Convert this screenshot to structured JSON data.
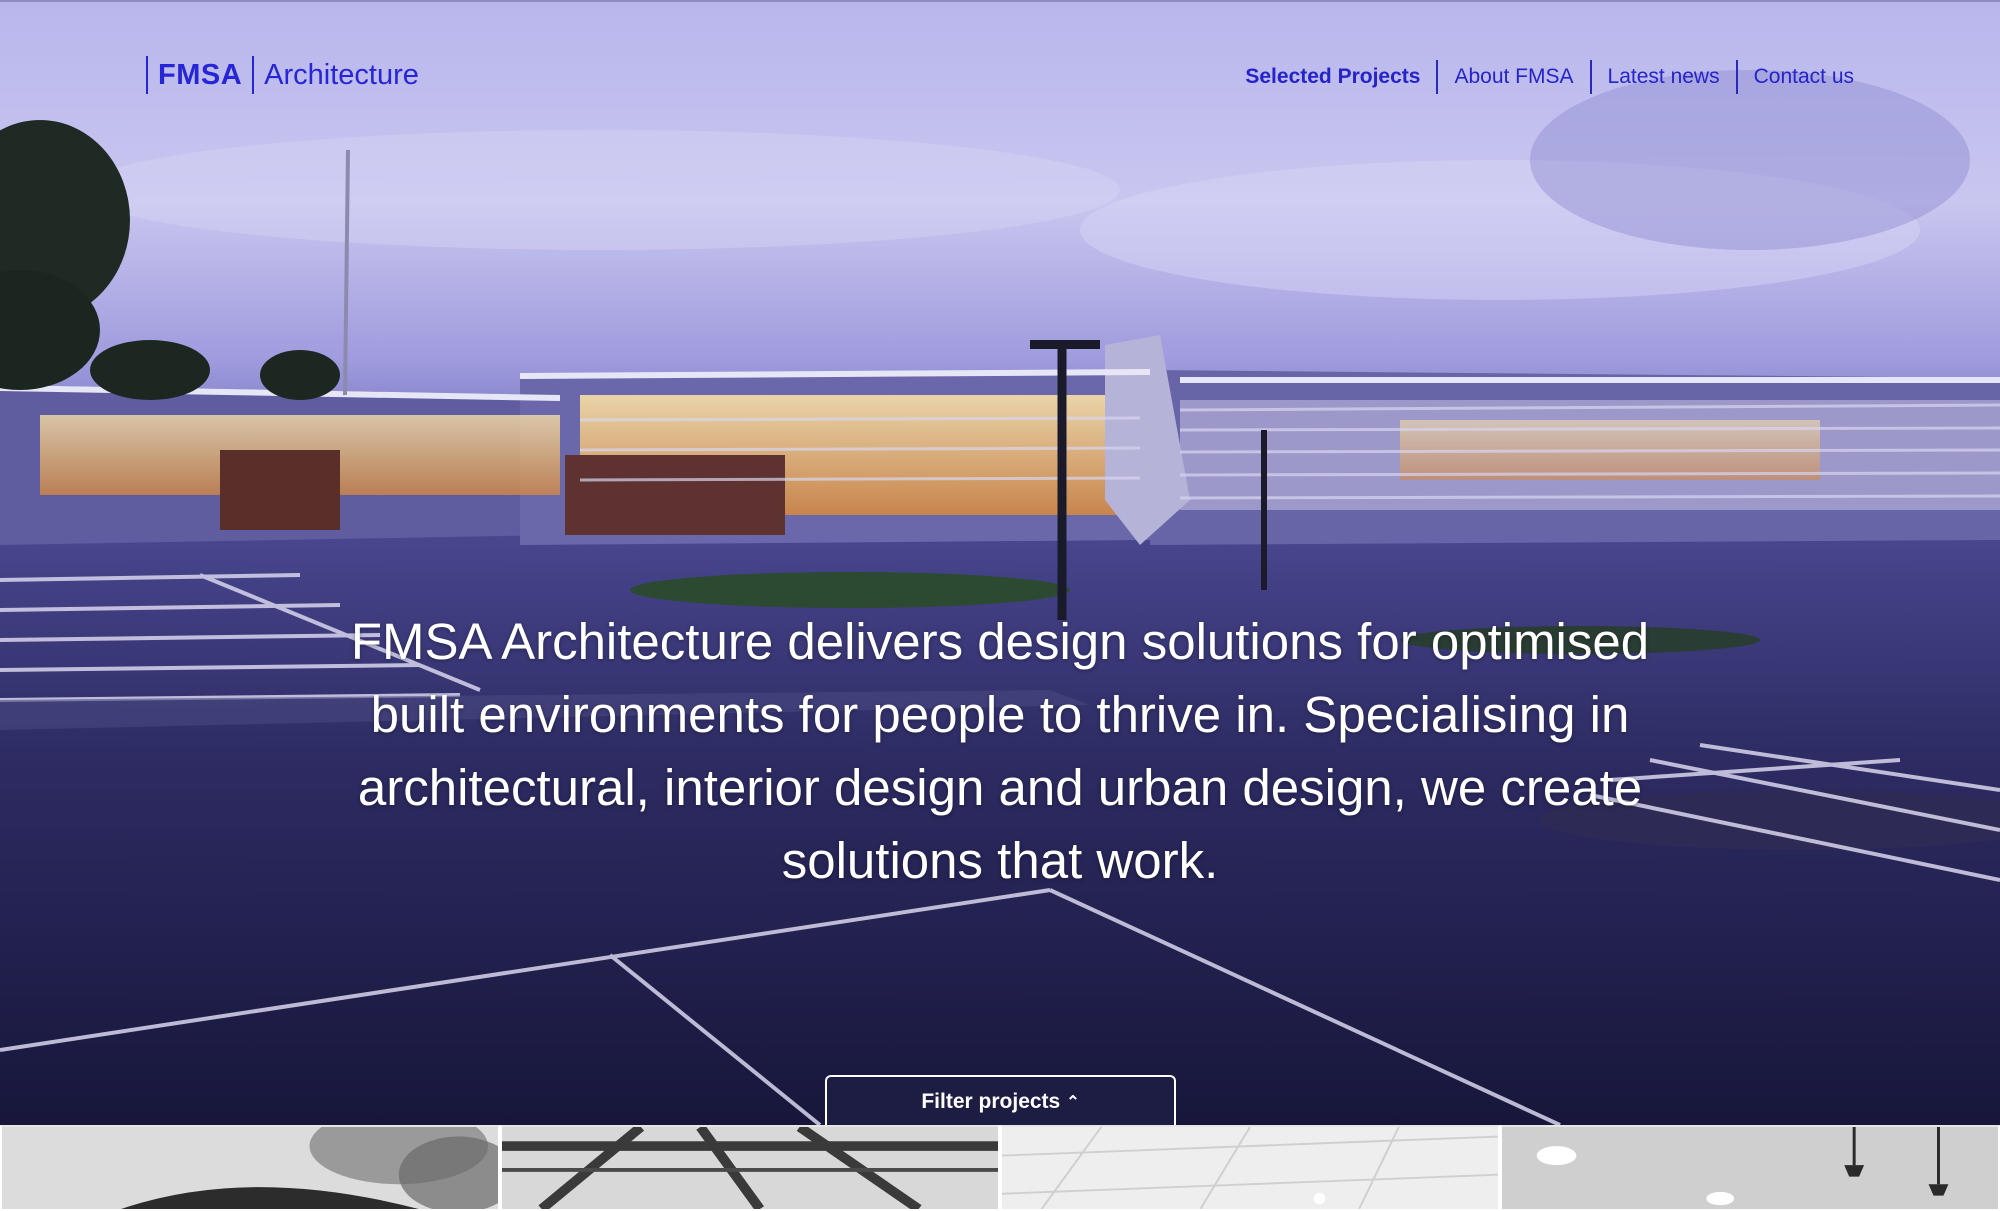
{
  "brand": {
    "name": "FMSA",
    "suffix": "Architecture"
  },
  "nav": {
    "items": [
      {
        "label": "Selected Projects",
        "active": true
      },
      {
        "label": "About FMSA",
        "active": false
      },
      {
        "label": "Latest news",
        "active": false
      },
      {
        "label": "Contact us",
        "active": false
      }
    ]
  },
  "hero": {
    "tagline": "FMSA Architecture delivers design solutions for optimised built environments for people to thrive in. Specialising in architectural, interior design and urban design, we create solutions that work.",
    "image": "photo of illuminated building at dusk with car park"
  },
  "filter": {
    "label": "Filter projects",
    "icon": "chevron-up-icon"
  },
  "projects": {
    "thumbnails": [
      {
        "image": "grayscale tree and curved roof"
      },
      {
        "image": "grayscale steel roof trusses"
      },
      {
        "image": "grayscale ceiling tiles"
      },
      {
        "image": "grayscale ceiling lights and pendant"
      }
    ]
  },
  "colors": {
    "accent": "#2626d6",
    "nav_text": "#2424c8",
    "hero_text": "#ffffff"
  }
}
